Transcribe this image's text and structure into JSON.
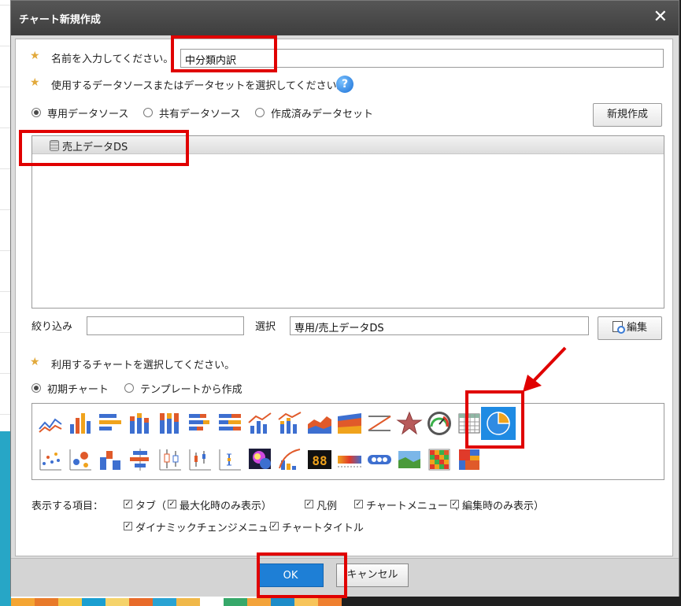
{
  "dialog": {
    "title": "チャート新規作成",
    "close": "✕"
  },
  "name_row": {
    "label": "名前を入力してください。",
    "value": "中分類内訳"
  },
  "source_row": {
    "label": "使用するデータソースまたはデータセットを選択してください。",
    "help": "?"
  },
  "source_options": [
    {
      "label": "専用データソース",
      "selected": true
    },
    {
      "label": "共有データソース",
      "selected": false
    },
    {
      "label": "作成済みデータセット",
      "selected": false
    }
  ],
  "new_button": "新規作成",
  "datasources": [
    {
      "label": "売上データDS",
      "icon": "database-icon"
    }
  ],
  "filter": {
    "label": "絞り込み",
    "value": ""
  },
  "selection": {
    "label": "選択",
    "value": "専用/売上データDS"
  },
  "edit_button": "編集",
  "chart_row": {
    "label": "利用するチャートを選択してください。"
  },
  "chart_options": [
    {
      "label": "初期チャート",
      "selected": true
    },
    {
      "label": "テンプレートから作成",
      "selected": false
    }
  ],
  "chart_icons": [
    "line-chart-icon",
    "column-chart-icon",
    "bar-chart-icon",
    "stacked-column-icon",
    "stacked-column-100-icon",
    "stacked-bar-icon",
    "stacked-bar-100-icon",
    "line-column-icon",
    "line-stacked-column-icon",
    "area-chart-icon",
    "stacked-area-icon",
    "step-line-icon",
    "pie-chart-icon",
    "radar-chart-icon",
    "gauge-icon",
    "table-icon",
    "scatter-icon",
    "bubble-icon",
    "step-chart-icon",
    "range-bar-icon",
    "box-plot-icon",
    "candlestick-icon",
    "error-bar-icon",
    "map-chart-icon",
    "pareto-icon",
    "digital-counter-icon",
    "gradient-bar-icon",
    "indicator-icon",
    "image-icon",
    "heatmap-icon",
    "treemap-icon"
  ],
  "selected_chart": "pie-chart-icon",
  "display_items": {
    "label": "表示する項目：",
    "checks": [
      {
        "label": "タブ（",
        "checked": true
      },
      {
        "label": "最大化時のみ表示）",
        "checked": true
      },
      {
        "label": "凡例",
        "checked": true
      },
      {
        "label": "チャートメニュー（",
        "checked": true
      },
      {
        "label": "編集時のみ表示）",
        "checked": true
      },
      {
        "label": "ダイナミックチェンジメニュー",
        "checked": true
      },
      {
        "label": "チャートタイトル",
        "checked": true
      }
    ]
  },
  "footer": {
    "ok": "OK",
    "cancel": "キャンセル"
  },
  "colors": {
    "accent": "#1e7fd6",
    "highlight": "#e00000",
    "selected_icon_bg": "#1f8be3"
  }
}
